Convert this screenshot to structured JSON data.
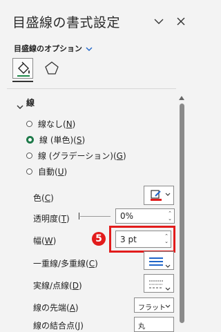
{
  "header": {
    "title": "目盛線の書式設定"
  },
  "options": {
    "label": "目盛線のオプション"
  },
  "tabs": [
    {
      "icon": "fill-line-icon"
    },
    {
      "icon": "effects-pentagon-icon"
    }
  ],
  "section": {
    "label": "線"
  },
  "radios": [
    {
      "text": "線なし(",
      "key": "N",
      "tail": ")",
      "selected": false
    },
    {
      "text": "線 (単色)(",
      "key": "S",
      "tail": ")",
      "selected": true
    },
    {
      "text": "線 (グラデーション)(",
      "key": "G",
      "tail": ")",
      "selected": false
    },
    {
      "text": "自動(",
      "key": "U",
      "tail": ")",
      "selected": false
    }
  ],
  "props": {
    "color": {
      "text": "色(",
      "key": "C",
      "tail": ")"
    },
    "transparency": {
      "text": "透明度(",
      "key": "T",
      "tail": ")",
      "value": "0%"
    },
    "width": {
      "text": "幅(",
      "key": "W",
      "tail": ")",
      "value": "3 pt"
    },
    "compound": {
      "text": "一重線/多重線(",
      "key": "C",
      "tail": ")"
    },
    "dash": {
      "text": "実線/点線(",
      "key": "D",
      "tail": ")"
    },
    "cap": {
      "text": "線の先端(",
      "key": "A",
      "tail": ")",
      "value": "フラット"
    },
    "join": {
      "text": "線の結合点(J)",
      "value": "丸"
    }
  },
  "annotation": {
    "number": "5"
  },
  "colors": {
    "accent_red": "#e21c1c",
    "radio_green": "#1f7a4a",
    "compound_blue": "#1e64c8"
  }
}
